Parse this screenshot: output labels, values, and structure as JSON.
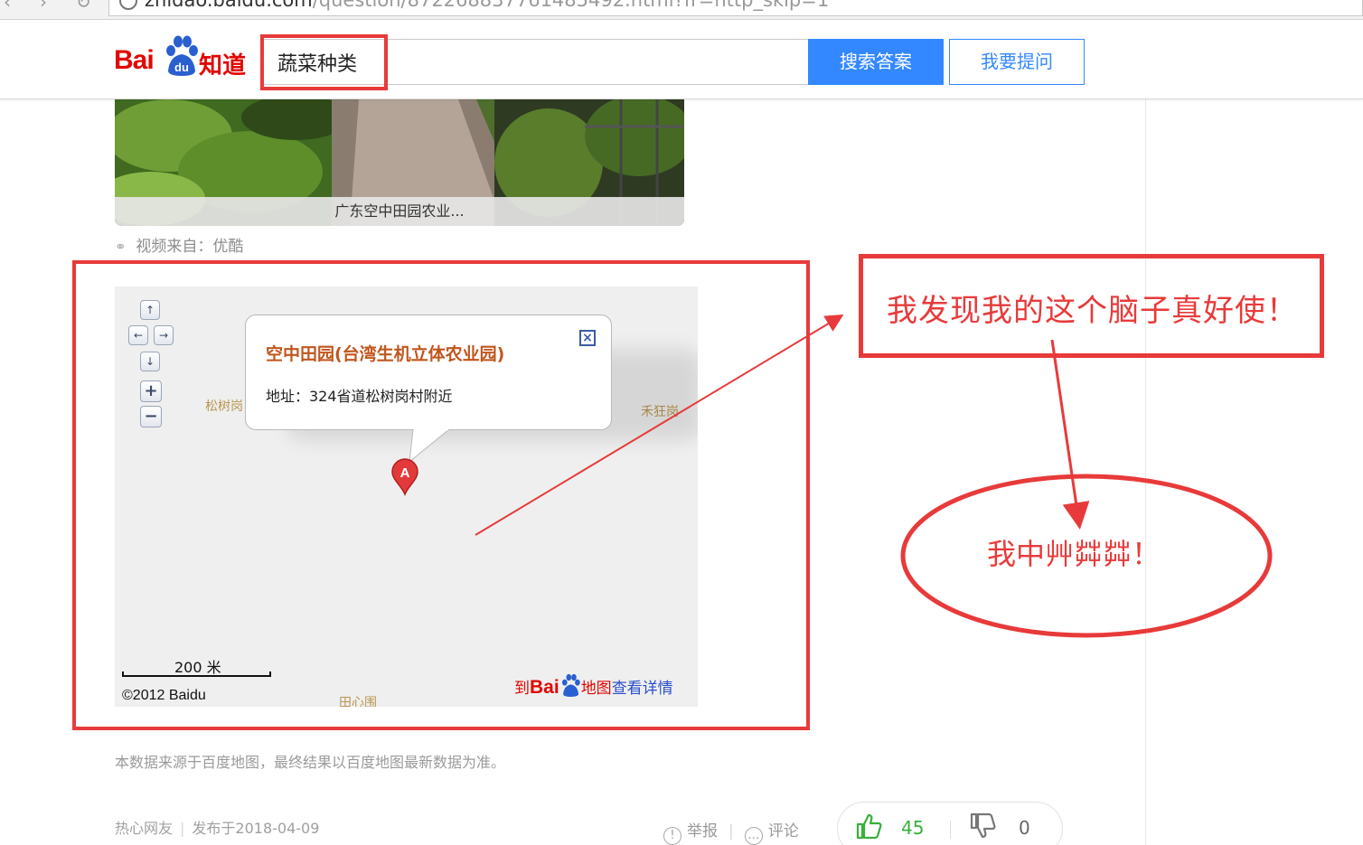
{
  "browser": {
    "url_host": "zhidao.baidu.com",
    "url_path": "/question/872268837761485492.html?fr=http_skip=1"
  },
  "header": {
    "logo_bai": "Bai",
    "logo_du": "du",
    "logo_zhidao": "知道",
    "search_value": "蔬菜种类",
    "search_button": "搜索答案",
    "ask_button": "我要提问"
  },
  "video": {
    "caption": "广东空中田园农业...",
    "source_label": "视频来自：优酷"
  },
  "map": {
    "popup_title": "空中田园(台湾生机立体农业园)",
    "popup_address": "地址：324省道松树岗村附近",
    "marker_label": "A",
    "place_left": "松树岗",
    "place_right": "禾狂岗",
    "place_bottom": "田心围",
    "scale_label": "200 米",
    "copyright": "©2012 Baidu",
    "link_prefix": "到",
    "link_brand_bai": "Bai",
    "link_brand_map": "地图",
    "link_suffix": "查看详情",
    "controls": {
      "up": "↑",
      "left": "←",
      "right": "→",
      "down": "↓",
      "zoom_in": "+",
      "zoom_out": "−"
    }
  },
  "notes": {
    "data_source": "本数据来源于百度地图，最终结果以百度地图最新数据为准。"
  },
  "footer": {
    "author": "热心网友",
    "published": "发布于2018-04-09",
    "report": "举报",
    "comment": "评论",
    "upvotes": "45",
    "downvotes": "0"
  },
  "annotations": {
    "box_text": "我发现我的这个脑子真好使！",
    "ellipse_text": "我中艸茻茻！",
    "color": "#e83a3a"
  },
  "colors": {
    "brand_red": "#e10601",
    "primary_blue": "#3388ff",
    "popup_title": "#c0561d",
    "upvote_green": "#38b03b"
  }
}
